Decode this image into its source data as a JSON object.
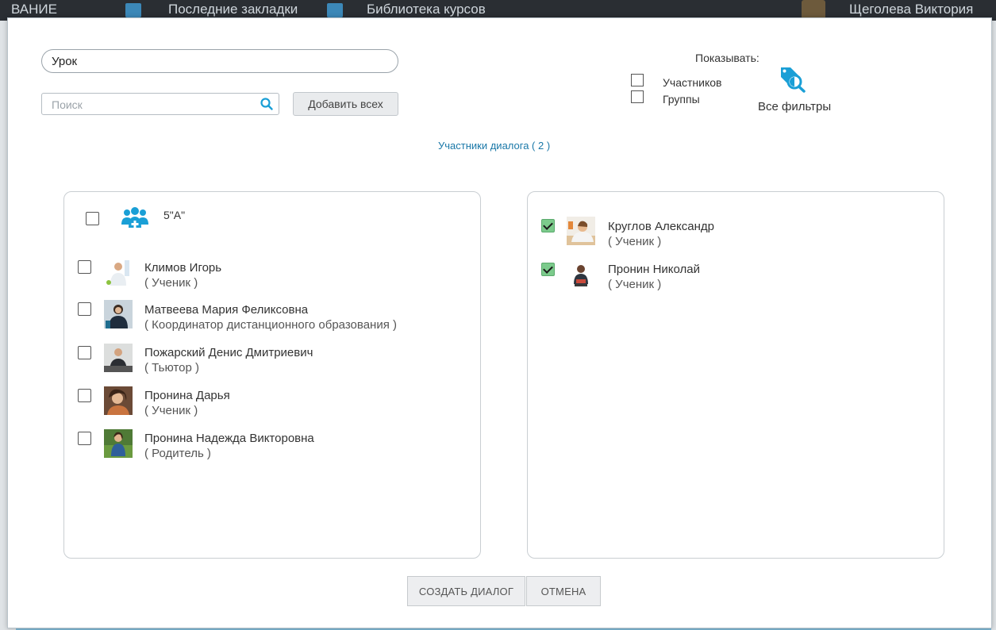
{
  "background": {
    "topbar_left": "ВАНИЕ",
    "topbar_bookmarks": "Последние закладки",
    "topbar_library": "Библиотека курсов",
    "topbar_user": "Щеголева Виктория"
  },
  "dialog": {
    "topic_value": "Урок",
    "search_placeholder": "Поиск",
    "add_all_label": "Добавить всех",
    "show_label": "Показывать:",
    "filter_participants_label": "Участников",
    "filter_groups_label": "Группы",
    "all_filters_label": "Все фильтры",
    "participants_title": "Участники диалога ( 2 )",
    "create_label": "СОЗДАТЬ ДИАЛОГ",
    "cancel_label": "ОТМЕНА"
  },
  "left_panel": {
    "group": {
      "name": "5\"А\"",
      "checked": false,
      "icon": "group-add-icon"
    },
    "people": [
      {
        "name": "Климов Игорь",
        "role": "( Ученик )",
        "checked": false
      },
      {
        "name": "Матвеева Мария Феликсовна",
        "role": "( Координатор дистанционного образования )",
        "checked": false
      },
      {
        "name": "Пожарский Денис Дмитриевич",
        "role": "( Тьютор )",
        "checked": false
      },
      {
        "name": "Пронина Дарья",
        "role": "( Ученик )",
        "checked": false
      },
      {
        "name": "Пронина Надежда Викторовна",
        "role": "( Родитель )",
        "checked": false
      }
    ]
  },
  "right_panel": {
    "people": [
      {
        "name": "Круглов Александр",
        "role": "( Ученик )",
        "checked": true
      },
      {
        "name": "Пронин Николай",
        "role": "( Ученик )",
        "checked": true
      }
    ]
  },
  "colors": {
    "accent": "#1a9fd6",
    "link": "#1a78a8",
    "checked": "#7ccb8c"
  }
}
